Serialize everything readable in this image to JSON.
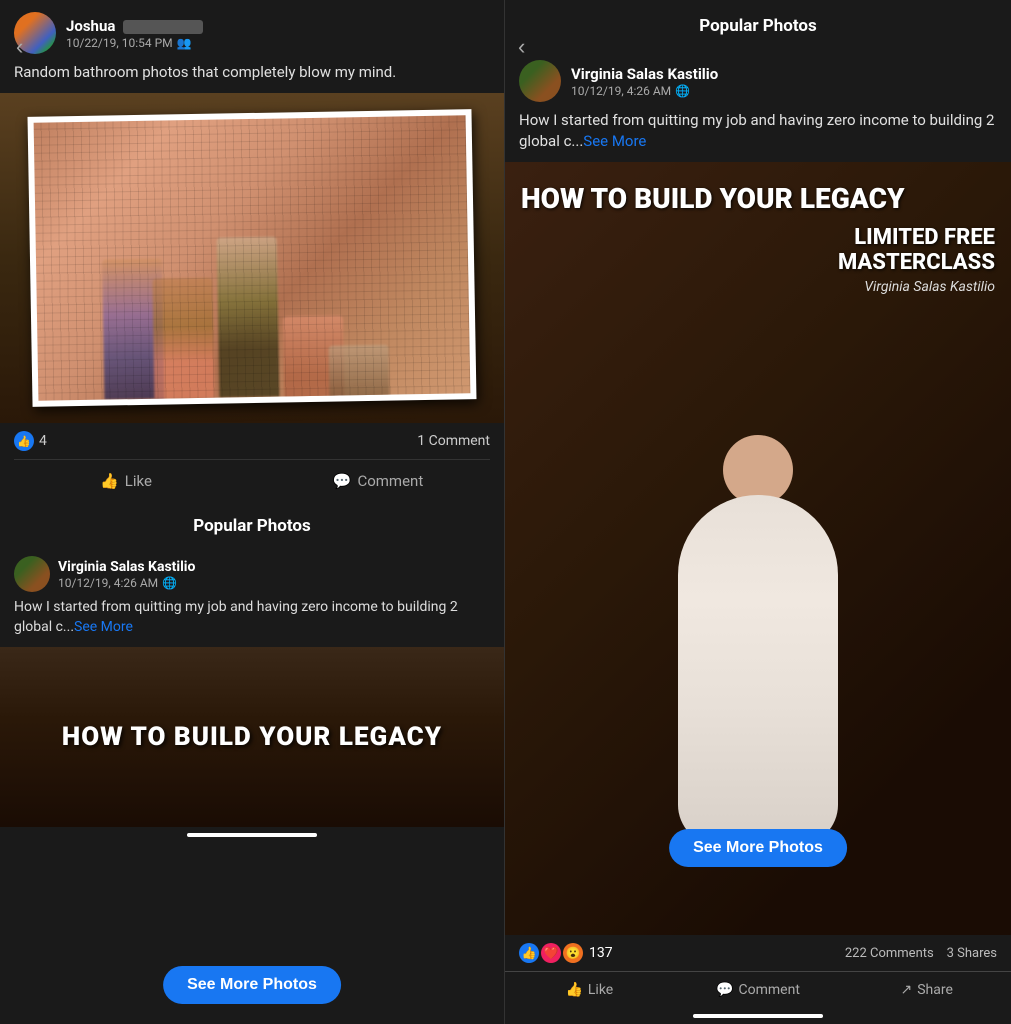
{
  "nav": {
    "left_arrow": "‹",
    "right_arrow": "‹"
  },
  "left_panel": {
    "post": {
      "author": "Joshua",
      "author_blurred": true,
      "time": "10/22/19, 10:54 PM",
      "audience_icon": "👥",
      "text": "Random bathroom photos that completely blow my mind.",
      "reactions_count": "4",
      "comments_count": "1 Comment",
      "like_label": "Like",
      "comment_label": "Comment"
    },
    "popular_section": {
      "title": "Popular Photos",
      "author": "Virginia Salas Kastilio",
      "time": "10/12/19, 4:26 AM",
      "globe_icon": "🌐",
      "text": "How I started from quitting my job and having zero income to building 2 global c...",
      "see_more": "See More",
      "image_text": "HOW TO BUILD YOUR LEGACY"
    },
    "see_more_btn": "See More Photos"
  },
  "right_panel": {
    "title": "Popular Photos",
    "post": {
      "author": "Virginia Salas Kastilio",
      "time": "10/12/19, 4:26 AM",
      "globe_icon": "🌐",
      "text": "How I started from quitting my job and having zero income to building 2 global c...",
      "see_more": "See More"
    },
    "image": {
      "title": "HOW TO BUILD YOUR LEGACY",
      "subtitle": "LIMITED FREE\nMASTERCLASS",
      "author_name": "Virginia Salas Kastilio"
    },
    "reactions_count": "137",
    "comments_count": "222 Comments",
    "shares_count": "3 Shares",
    "like_label": "Like",
    "comment_label": "Comment",
    "share_label": "Share",
    "see_more_btn": "See More Photos"
  }
}
